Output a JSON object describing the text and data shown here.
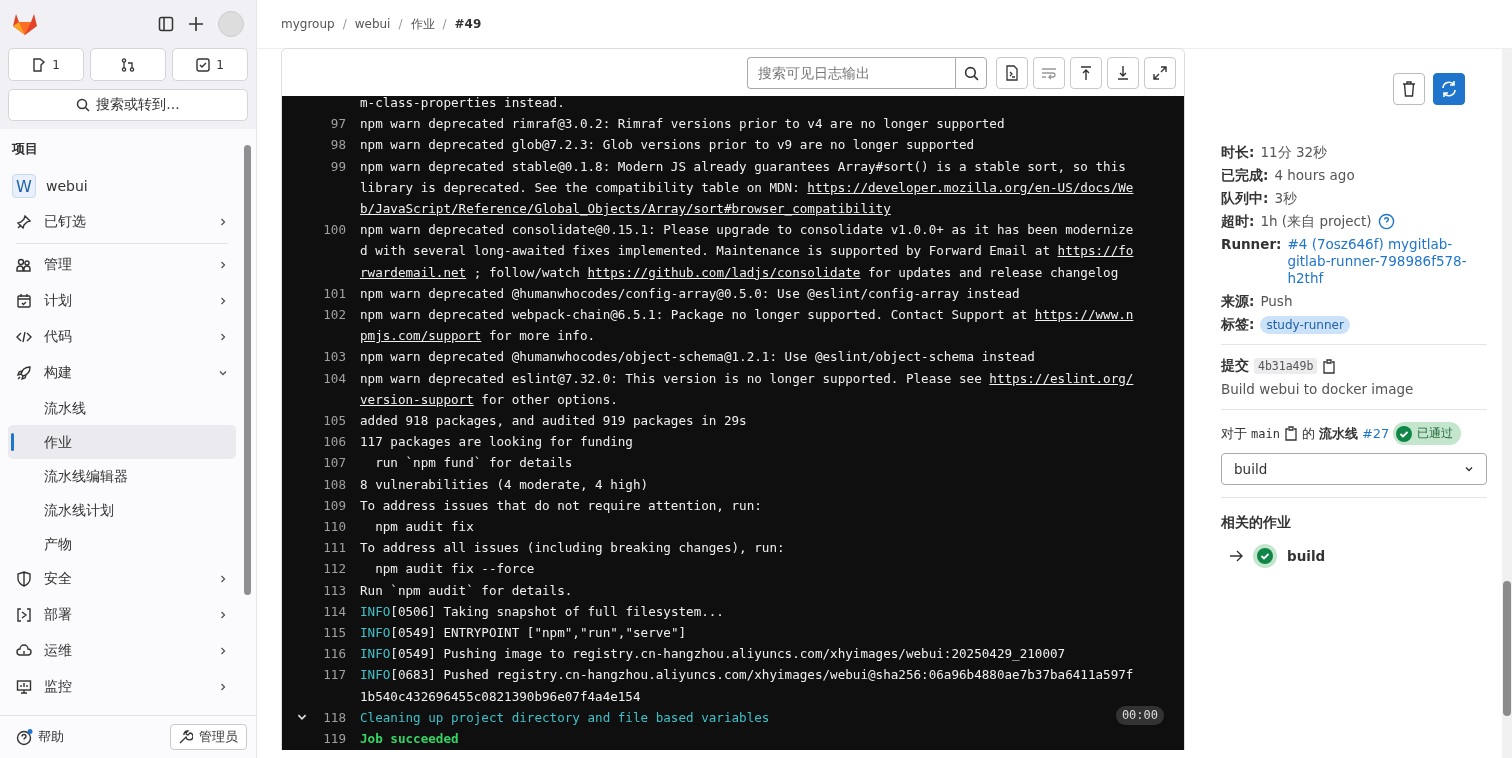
{
  "sidebar": {
    "counters": [
      {
        "kind": "issues",
        "count": "1"
      },
      {
        "kind": "merge_requests"
      },
      {
        "kind": "todos",
        "count": "1"
      }
    ],
    "search": "搜索或转到...",
    "section": "项目",
    "project": {
      "avatar": "W",
      "name": "webui"
    },
    "items": [
      {
        "label": "已钉选",
        "expanded": false
      },
      {
        "label": "管理",
        "expanded": false
      },
      {
        "label": "计划",
        "expanded": false
      },
      {
        "label": "代码",
        "expanded": false
      },
      {
        "label": "构建",
        "expanded": true,
        "children": [
          {
            "label": "流水线",
            "selected": false
          },
          {
            "label": "作业",
            "selected": true
          },
          {
            "label": "流水线编辑器",
            "selected": false
          },
          {
            "label": "流水线计划",
            "selected": false
          },
          {
            "label": "产物",
            "selected": false
          }
        ]
      },
      {
        "label": "安全",
        "expanded": false
      },
      {
        "label": "部署",
        "expanded": false
      },
      {
        "label": "运维",
        "expanded": false
      },
      {
        "label": "监控",
        "expanded": false
      }
    ],
    "help": "帮助",
    "admin": "管理员"
  },
  "breadcrumb": {
    "separator": "/",
    "items": [
      "mygroup",
      "webui",
      "作业",
      "#49"
    ]
  },
  "log": {
    "search_placeholder": "搜索可见日志输出",
    "lines": [
      {
        "segments": [
          {
            "kind": "plain",
            "text": "m-class-properties instead."
          }
        ]
      },
      {
        "number": "97",
        "segments": [
          {
            "kind": "plain",
            "text": "npm warn deprecated rimraf@3.0.2: Rimraf versions prior to v4 are no longer supported"
          }
        ]
      },
      {
        "number": "98",
        "segments": [
          {
            "kind": "plain",
            "text": "npm warn deprecated glob@7.2.3: Glob versions prior to v9 are no longer supported"
          }
        ]
      },
      {
        "number": "99",
        "segments": [
          {
            "kind": "plain",
            "text": "npm warn deprecated stable@0.1.8: Modern JS already guarantees Array#sort() is a stable sort, so this library is deprecated. See the compatibility table on MDN: "
          },
          {
            "kind": "link",
            "text": "https://developer.mozilla.org/en-US/docs/Web/JavaScript/Reference/Global_Objects/Array/sort#browser_compatibility"
          }
        ]
      },
      {
        "number": "100",
        "segments": [
          {
            "kind": "plain",
            "text": "npm warn deprecated consolidate@0.15.1: Please upgrade to consolidate v1.0.0+ as it has been modernized with several long-awaited fixes implemented. Maintenance is supported by Forward Email at "
          },
          {
            "kind": "link",
            "text": "https://forwardemail.net"
          },
          {
            "kind": "plain",
            "text": " ; follow/watch "
          },
          {
            "kind": "link",
            "text": "https://github.com/ladjs/consolidate"
          },
          {
            "kind": "plain",
            "text": " for updates and release changelog"
          }
        ]
      },
      {
        "number": "101",
        "segments": [
          {
            "kind": "plain",
            "text": "npm warn deprecated @humanwhocodes/config-array@0.5.0: Use @eslint/config-array instead"
          }
        ]
      },
      {
        "number": "102",
        "segments": [
          {
            "kind": "plain",
            "text": "npm warn deprecated webpack-chain@6.5.1: Package no longer supported. Contact Support at "
          },
          {
            "kind": "link",
            "text": "https://www.npmjs.com/support"
          },
          {
            "kind": "plain",
            "text": " for more info."
          }
        ]
      },
      {
        "number": "103",
        "segments": [
          {
            "kind": "plain",
            "text": "npm warn deprecated @humanwhocodes/object-schema@1.2.1: Use @eslint/object-schema instead"
          }
        ]
      },
      {
        "number": "104",
        "segments": [
          {
            "kind": "plain",
            "text": "npm warn deprecated eslint@7.32.0: This version is no longer supported. Please see "
          },
          {
            "kind": "link",
            "text": "https://eslint.org/version-support"
          },
          {
            "kind": "plain",
            "text": " for other options."
          }
        ]
      },
      {
        "number": "105",
        "segments": [
          {
            "kind": "plain",
            "text": "added 918 packages, and audited 919 packages in 29s"
          }
        ]
      },
      {
        "number": "106",
        "segments": [
          {
            "kind": "plain",
            "text": "117 packages are looking for funding"
          }
        ]
      },
      {
        "number": "107",
        "segments": [
          {
            "kind": "plain",
            "text": "  run `npm fund` for details"
          }
        ]
      },
      {
        "number": "108",
        "segments": [
          {
            "kind": "plain",
            "text": "8 vulnerabilities (4 moderate, 4 high)"
          }
        ]
      },
      {
        "number": "109",
        "segments": [
          {
            "kind": "plain",
            "text": "To address issues that do not require attention, run:"
          }
        ]
      },
      {
        "number": "110",
        "segments": [
          {
            "kind": "plain",
            "text": "  npm audit fix"
          }
        ]
      },
      {
        "number": "111",
        "segments": [
          {
            "kind": "plain",
            "text": "To address all issues (including breaking changes), run:"
          }
        ]
      },
      {
        "number": "112",
        "segments": [
          {
            "kind": "plain",
            "text": "  npm audit fix --force"
          }
        ]
      },
      {
        "number": "113",
        "segments": [
          {
            "kind": "plain",
            "text": "Run `npm audit` for details."
          }
        ]
      },
      {
        "number": "114",
        "segments": [
          {
            "kind": "info",
            "text": "INFO"
          },
          {
            "kind": "plain",
            "text": "[0506] Taking snapshot of full filesystem..."
          }
        ]
      },
      {
        "number": "115",
        "segments": [
          {
            "kind": "info",
            "text": "INFO"
          },
          {
            "kind": "plain",
            "text": "[0549] ENTRYPOINT [\"npm\",\"run\",\"serve\"]"
          }
        ]
      },
      {
        "number": "116",
        "segments": [
          {
            "kind": "info",
            "text": "INFO"
          },
          {
            "kind": "plain",
            "text": "[0549] Pushing image to registry.cn-hangzhou.aliyuncs.com/xhyimages/webui:20250429_210007"
          }
        ]
      },
      {
        "number": "117",
        "segments": [
          {
            "kind": "info",
            "text": "INFO"
          },
          {
            "kind": "plain",
            "text": "[0683] Pushed registry.cn-hangzhou.aliyuncs.com/xhyimages/webui@sha256:06a96b4880ae7b37ba6411a597f1b540c432696455c0821390b96e07f4a4e154"
          }
        ]
      },
      {
        "number": "118",
        "section": {
          "expanded": true,
          "duration": "00:00"
        },
        "segments": [
          {
            "kind": "info",
            "text": "Cleaning up project directory and file based variables"
          }
        ]
      },
      {
        "number": "119",
        "segments": [
          {
            "kind": "success",
            "text": "Job succeeded"
          }
        ]
      }
    ]
  },
  "details": {
    "rows": [
      {
        "label": "时长:",
        "value": "11分 32秒",
        "kind": "text"
      },
      {
        "label": "已完成:",
        "value": "4 hours ago",
        "kind": "text"
      },
      {
        "label": "队列中:",
        "value": "3秒",
        "kind": "text"
      },
      {
        "label": "超时:",
        "value": "1h (来自 project)",
        "kind": "help"
      },
      {
        "label": "Runner:",
        "value": "#4 (7osz646f) mygitlab-gitlab-runner-798986f578-h2thf",
        "kind": "link"
      },
      {
        "label": "来源:",
        "value": "Push",
        "kind": "text"
      },
      {
        "label": "标签:",
        "value": "study-runner",
        "kind": "tag"
      }
    ],
    "commit": {
      "label": "提交",
      "sha": "4b31a49b",
      "message": "Build webui to docker image"
    },
    "pipeline": {
      "prefix": "对于",
      "ref": "main",
      "of": "的",
      "label": "流水线",
      "number": "#27",
      "status": "已通过"
    },
    "stage": "build",
    "related_title": "相关的作业",
    "related": [
      {
        "name": "build"
      }
    ]
  }
}
